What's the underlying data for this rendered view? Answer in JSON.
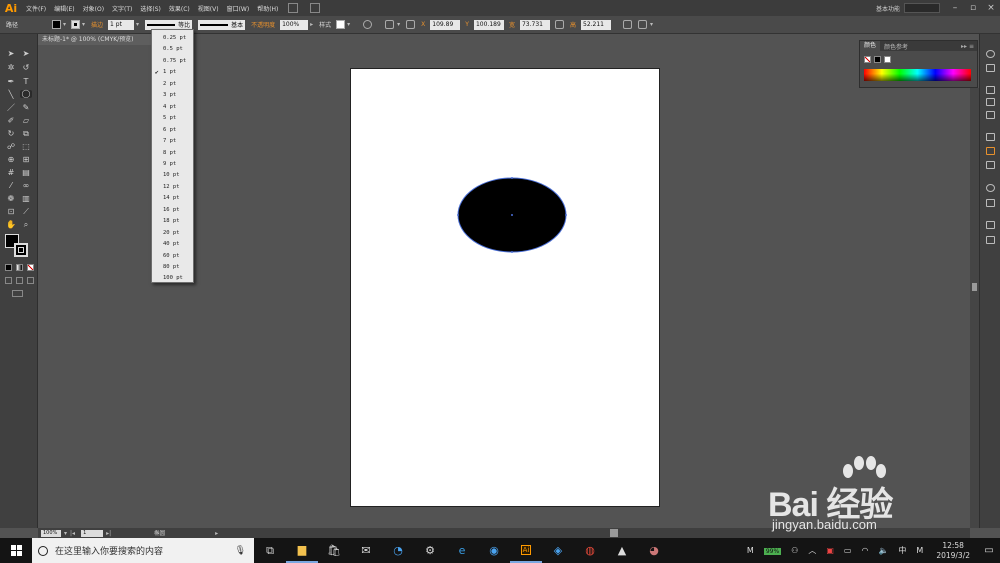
{
  "app": {
    "logo": "Ai"
  },
  "menu": {
    "items": [
      "文件(F)",
      "编辑(E)",
      "对象(O)",
      "文字(T)",
      "选择(S)",
      "效果(C)",
      "视图(V)",
      "窗口(W)",
      "帮助(H)"
    ],
    "workspace": "基本功能"
  },
  "control_bar": {
    "selection_label": "路径",
    "stroke_label": "描边",
    "stroke_weight": "1 pt",
    "profile_label": "等比",
    "brush_label": "基本",
    "opacity_label": "不透明度",
    "opacity_value": "100%",
    "style_label": "样式",
    "x_label": "X",
    "x_value": "109.89",
    "y_label": "Y",
    "y_value": "100.189",
    "w_label": "宽",
    "w_value": "73.731",
    "h_label": "高",
    "h_value": "52.211"
  },
  "document": {
    "tab_title": "未标题-1* @ 100% (CMYK/预览)",
    "close_glyph": "×",
    "zoom": "100%",
    "page": "1",
    "status_text": "椭圆"
  },
  "stroke_dropdown": {
    "options": [
      "0.25 pt",
      "0.5 pt",
      "0.75 pt",
      "1 pt",
      "2 pt",
      "3 pt",
      "4 pt",
      "5 pt",
      "6 pt",
      "7 pt",
      "8 pt",
      "9 pt",
      "10 pt",
      "12 pt",
      "14 pt",
      "16 pt",
      "18 pt",
      "20 pt",
      "40 pt",
      "60 pt",
      "80 pt",
      "100 pt"
    ],
    "selected": "1 pt",
    "check_glyph": "✔"
  },
  "color_panel": {
    "tabs": [
      "颜色",
      "颜色参考"
    ],
    "menu_glyph": "▸▸ ≡"
  },
  "colors": {
    "accent": "#ff9a00",
    "selection_path": "#4a6fd8",
    "fill": "#000000",
    "artboard": "#ffffff"
  },
  "taskbar": {
    "search_placeholder": "在这里输入你要搜索的内容",
    "battery": "99%",
    "ime": "中",
    "ime_m": "M",
    "time": "12:58",
    "date": "2019/3/2"
  },
  "watermark": {
    "brand": "Bai 经验",
    "url": "jingyan.baidu.com"
  }
}
